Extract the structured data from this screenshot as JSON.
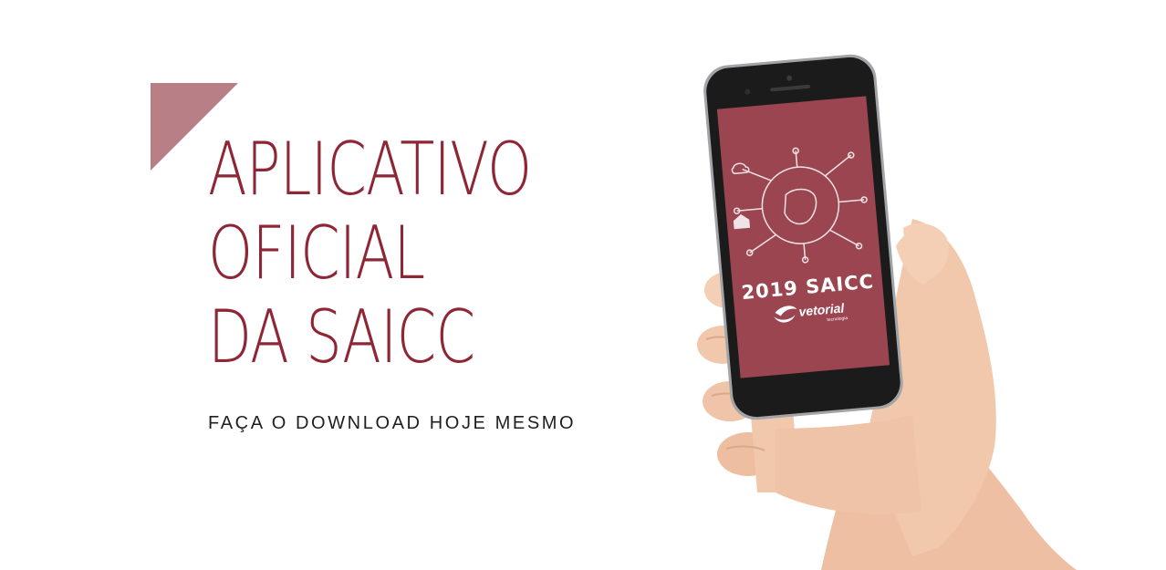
{
  "hero": {
    "headline_lines": [
      "APLICATIVO",
      "OFICIAL",
      "DA SAICC"
    ],
    "subline": "FAÇA O DOWNLOAD HOJE MESMO"
  },
  "phone_screen": {
    "app_title": "2019 SAICC",
    "brand": "vetorial",
    "brand_tagline": "tecnologia"
  },
  "colors": {
    "accent": "#8e2636",
    "accent_light": "#b97f86",
    "screen_bg": "#9b4551",
    "phone_body": "#1b1b1c",
    "skin": "#f2c8ad"
  }
}
